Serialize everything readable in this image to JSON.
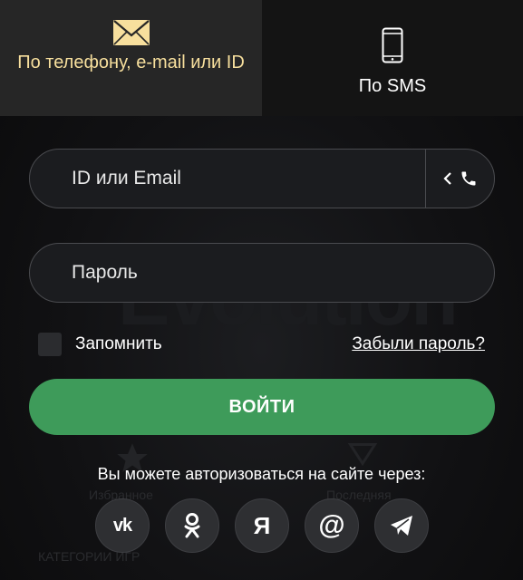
{
  "tabs": [
    {
      "label": "По телефону, e-mail или ID",
      "icon": "envelope-icon",
      "active": true
    },
    {
      "label": "По SMS",
      "icon": "mobile-phone-icon",
      "active": false
    }
  ],
  "login": {
    "placeholder": "ID или Email",
    "switch_icons": [
      "chevron-left-icon",
      "phone-icon"
    ]
  },
  "password": {
    "placeholder": "Пароль"
  },
  "remember": {
    "label": "Запомнить",
    "checked": false
  },
  "forgot_label": "Забыли пароль?",
  "login_button": "ВОЙТИ",
  "social": {
    "title": "Вы можете авторизоваться на сайте через:",
    "items": [
      {
        "name": "vk",
        "glyph": "vk"
      },
      {
        "name": "odnoklassniki",
        "glyph": ""
      },
      {
        "name": "yandex",
        "glyph": "Я"
      },
      {
        "name": "mail",
        "glyph": "@"
      },
      {
        "name": "telegram",
        "glyph": ""
      }
    ]
  },
  "background": {
    "watermark": "Evolution",
    "labels": [
      "Избранное",
      "Последняя",
      "КАТЕГОРИИ ИГР"
    ]
  },
  "colors": {
    "active_tab_bg": "#262626",
    "active_tab_text": "#f7df9d",
    "login_button": "#3e9b5a",
    "field_border": "#4a4b4f"
  }
}
